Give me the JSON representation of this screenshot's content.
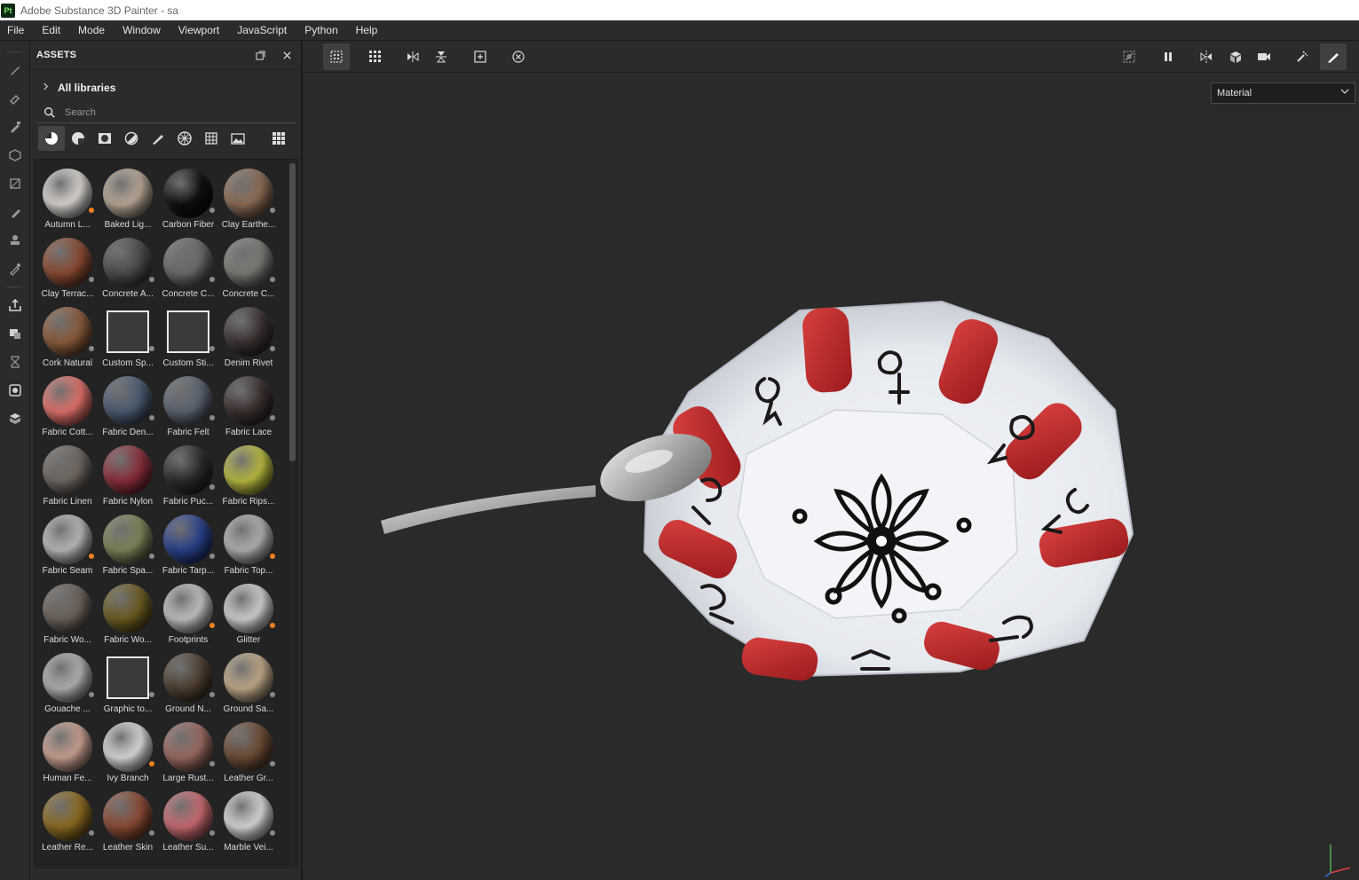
{
  "window": {
    "logo": "Pt",
    "title": "Adobe Substance 3D Painter - sa"
  },
  "menu": [
    "File",
    "Edit",
    "Mode",
    "Window",
    "Viewport",
    "JavaScript",
    "Python",
    "Help"
  ],
  "assets_panel": {
    "title": "ASSETS",
    "library_label": "All libraries",
    "search_placeholder": "Search"
  },
  "viewport": {
    "mode_select": "Material"
  },
  "assets": [
    {
      "label": "Autumn L...",
      "color": "#d8d4d0",
      "badge": "orange"
    },
    {
      "label": "Baked Lig...",
      "color": "#b8a896",
      "badge": "none"
    },
    {
      "label": "Carbon Fiber",
      "color": "#0e0e0e",
      "badge": "gray"
    },
    {
      "label": "Clay Earthe...",
      "color": "#8c6c56",
      "badge": "gray"
    },
    {
      "label": "Clay Terrac...",
      "color": "#8a4a32",
      "badge": "gray"
    },
    {
      "label": "Concrete A...",
      "color": "#4a4a4c",
      "badge": "gray"
    },
    {
      "label": "Concrete C...",
      "color": "#6a6a6a",
      "badge": "gray"
    },
    {
      "label": "Concrete C...",
      "color": "#7c7a76",
      "badge": "gray"
    },
    {
      "label": "Cork Natural",
      "color": "#8a5a3a",
      "badge": "gray"
    },
    {
      "label": "Custom Sp...",
      "color": "#3a3a3a",
      "badge": "gray",
      "flat": true
    },
    {
      "label": "Custom Sti...",
      "color": "#3a3a3a",
      "badge": "gray",
      "flat": true
    },
    {
      "label": "Denim Rivet",
      "color": "#3a3030",
      "badge": "gray"
    },
    {
      "label": "Fabric Cott...",
      "color": "#e0706a",
      "badge": "none"
    },
    {
      "label": "Fabric Den...",
      "color": "#4a5a70",
      "badge": "gray"
    },
    {
      "label": "Fabric Felt",
      "color": "#5a6270",
      "badge": "gray"
    },
    {
      "label": "Fabric Lace",
      "color": "#3a2e2e",
      "badge": "gray"
    },
    {
      "label": "Fabric Linen",
      "color": "#6e6660",
      "badge": "none"
    },
    {
      "label": "Fabric Nylon",
      "color": "#8a2e3a",
      "badge": "none"
    },
    {
      "label": "Fabric Puc...",
      "color": "#2a2a2a",
      "badge": "gray"
    },
    {
      "label": "Fabric Rips...",
      "color": "#b8b840",
      "badge": "none"
    },
    {
      "label": "Fabric Seam",
      "color": "#b8b8b8",
      "badge": "orange"
    },
    {
      "label": "Fabric Spa...",
      "color": "#7a8458",
      "badge": "gray"
    },
    {
      "label": "Fabric Tarp...",
      "color": "#28408a",
      "badge": "gray"
    },
    {
      "label": "Fabric Top...",
      "color": "#b0b0b0",
      "badge": "orange"
    },
    {
      "label": "Fabric Wo...",
      "color": "#6a6058",
      "badge": "none"
    },
    {
      "label": "Fabric Wo...",
      "color": "#6a5a20",
      "badge": "none"
    },
    {
      "label": "Footprints",
      "color": "#c0c0c0",
      "badge": "orange"
    },
    {
      "label": "Glitter",
      "color": "#cfcfcf",
      "badge": "orange"
    },
    {
      "label": "Gouache ...",
      "color": "#b0b0b0",
      "badge": "gray"
    },
    {
      "label": "Graphic to...",
      "color": "#3a3a3a",
      "badge": "gray",
      "flat": true
    },
    {
      "label": "Ground N...",
      "color": "#4e3e30",
      "badge": "gray"
    },
    {
      "label": "Ground Sa...",
      "color": "#c0a888",
      "badge": "gray"
    },
    {
      "label": "Human Fe...",
      "color": "#c8a090",
      "badge": "none"
    },
    {
      "label": "Ivy Branch",
      "color": "#d8d8d8",
      "badge": "orange"
    },
    {
      "label": "Large Rust...",
      "color": "#9a6a60",
      "badge": "gray"
    },
    {
      "label": "Leather Gr...",
      "color": "#6a4a34",
      "badge": "gray"
    },
    {
      "label": "Leather Re...",
      "color": "#8a6a20",
      "badge": "gray"
    },
    {
      "label": "Leather Skin",
      "color": "#8a4a34",
      "badge": "gray"
    },
    {
      "label": "Leather Su...",
      "color": "#c86a70",
      "badge": "gray"
    },
    {
      "label": "Marble Vei...",
      "color": "#d6d6d6",
      "badge": "gray"
    }
  ]
}
